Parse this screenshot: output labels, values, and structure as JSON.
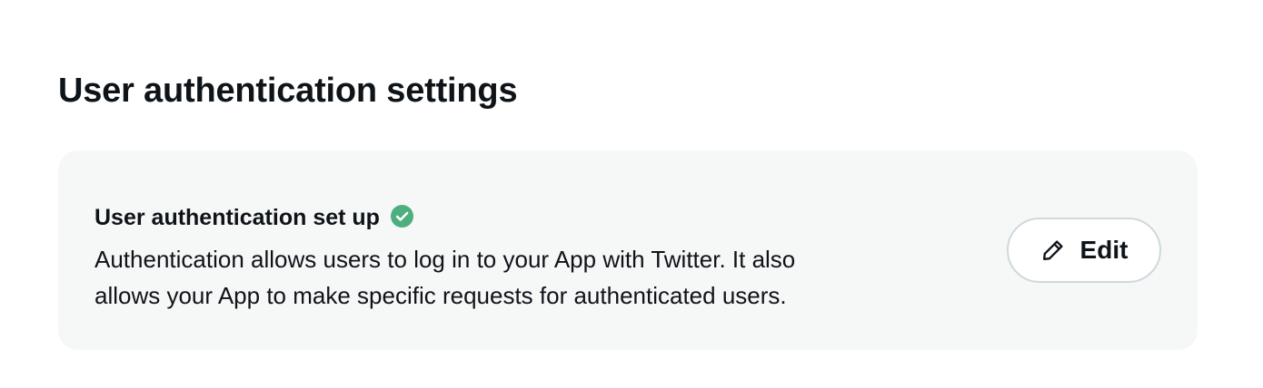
{
  "section": {
    "title": "User authentication settings"
  },
  "card": {
    "heading": "User authentication set up",
    "status_icon": "check-circle-icon",
    "status_color": "#4caf7d",
    "description_line1": "Authentication allows users to log in to your App with Twitter. It also",
    "description_line2": "allows your App to make specific requests for authenticated users.",
    "edit_button": {
      "label": "Edit",
      "icon": "pencil-icon"
    }
  }
}
